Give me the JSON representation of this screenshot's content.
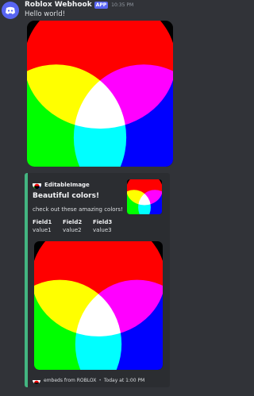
{
  "message": {
    "username": "Roblox Webhook",
    "badge": "APP",
    "timestamp": "10:35 PM",
    "text": "Hello world!"
  },
  "embed": {
    "accent_color": "#43b581",
    "author": "EditableImage",
    "title": "Beautiful colors!",
    "description": "check out these amazing colors!",
    "fields": [
      {
        "name": "Field1",
        "value": "value1"
      },
      {
        "name": "Field2",
        "value": "value2"
      },
      {
        "name": "Field3",
        "value": "value3"
      }
    ],
    "footer_text": "embeds from ROBLOX",
    "footer_separator": "•",
    "footer_time": "Today at 1:00 PM"
  },
  "icons": {
    "avatar": "discord-logo-icon",
    "author_icon": "color-wheel-icon",
    "footer_icon": "color-wheel-icon"
  }
}
